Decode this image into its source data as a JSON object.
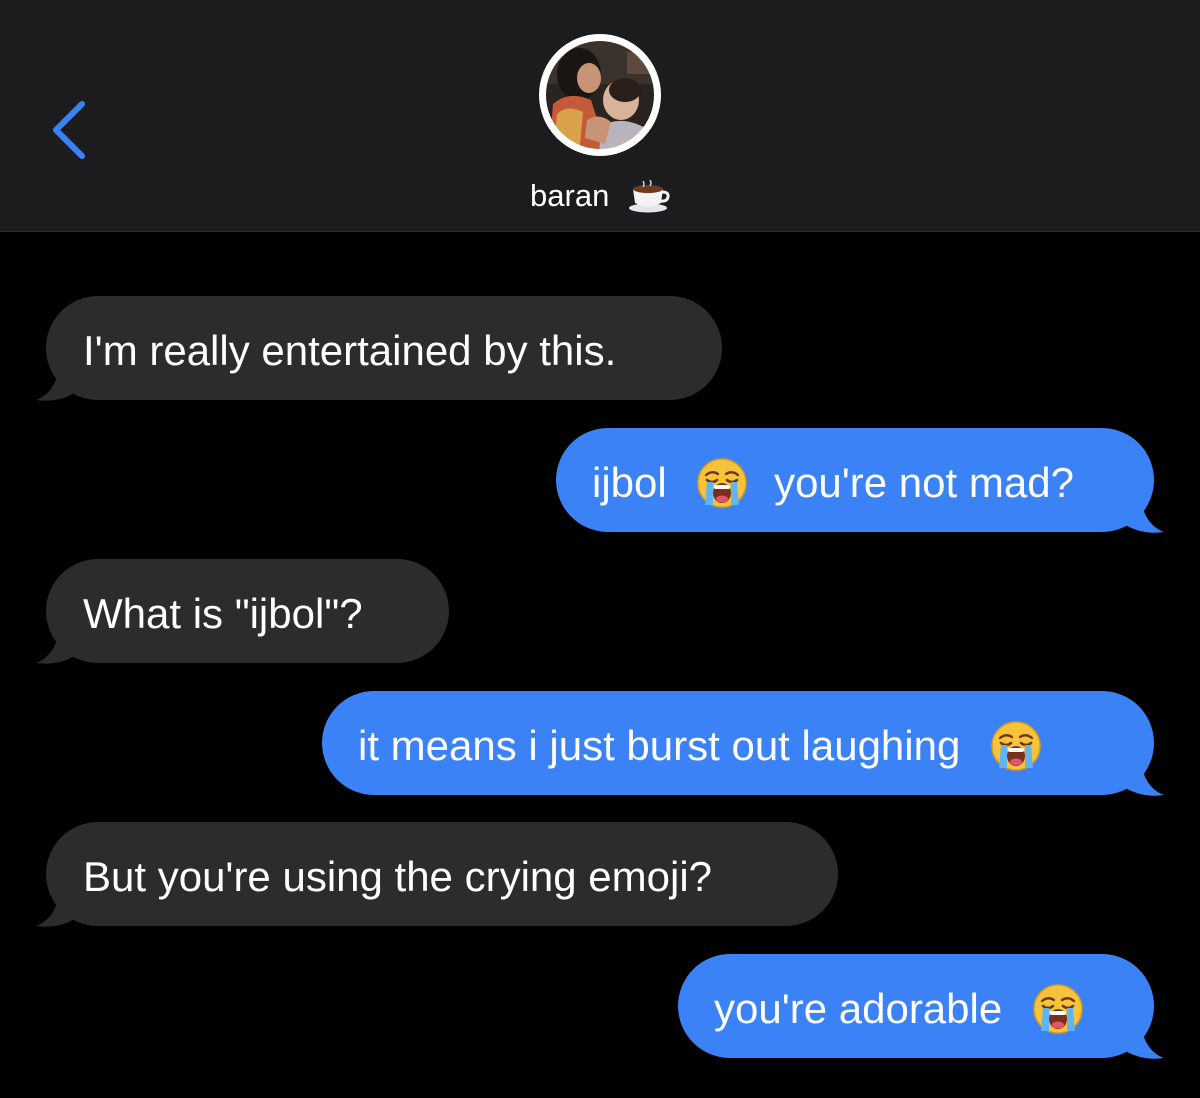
{
  "header": {
    "contact_name": "baran",
    "contact_emoji_icon": "hot-beverage-icon",
    "back_icon": "chevron-left-icon",
    "avatar_icon": "contact-photo"
  },
  "colors": {
    "background": "#000000",
    "header_background": "#1c1c1e",
    "incoming_bubble": "#2c2c2e",
    "outgoing_bubble": "#3b82f6",
    "accent": "#3b82f6",
    "text": "#ffffff"
  },
  "messages": [
    {
      "direction": "incoming",
      "text": "I'm really entertained by this."
    },
    {
      "direction": "outgoing",
      "text_before": "ijbol",
      "emoji_icon": "loudly-crying-face-icon",
      "text_after": "you're not mad?"
    },
    {
      "direction": "incoming",
      "text": "What is \"ijbol\"?"
    },
    {
      "direction": "outgoing",
      "text": "it means i just burst out laughing",
      "emoji_icon": "loudly-crying-face-icon"
    },
    {
      "direction": "incoming",
      "text": "But you're using the crying emoji?"
    },
    {
      "direction": "outgoing",
      "text": "you're adorable",
      "emoji_icon": "loudly-crying-face-icon"
    }
  ]
}
